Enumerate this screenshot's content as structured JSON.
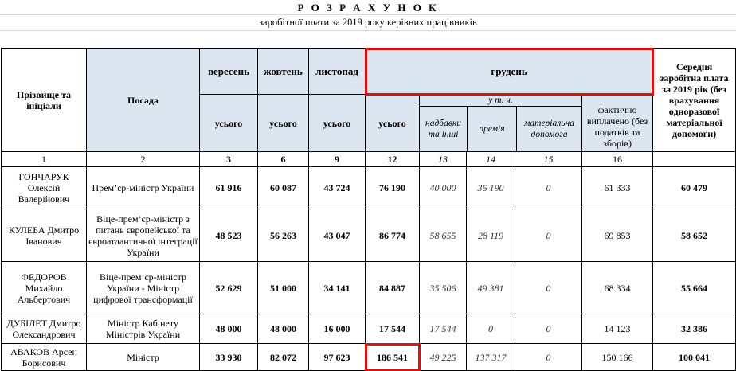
{
  "title": "Р О З Р А Х У Н О К",
  "subtitle": "заробітної плати за 2019 року керівних працівників",
  "headers": {
    "name": "Прізвище та ініціали",
    "position": "Посада",
    "sep": "вересень",
    "oct": "жовтень",
    "nov": "листопад",
    "dec": "грудень",
    "avg": "Середня заробітна плата за 2019 рік (без врахування одноразової матеріальної допомоги)",
    "total": "усього",
    "incl": "у т. ч.",
    "bonus_other": "надбавки та інші",
    "premium": "премія",
    "aid": "матеріальна допомога",
    "paid": "фактично виплачено (без податків та зборів)"
  },
  "col_numbers": [
    "1",
    "2",
    "3",
    "6",
    "9",
    "12",
    "13",
    "14",
    "15",
    "16",
    ""
  ],
  "rows": [
    {
      "name": "ГОНЧАРУК Олексій Валерійович",
      "position": "Прем’єр-міністр України",
      "sep": "61 916",
      "oct": "60 087",
      "nov": "43 724",
      "dec_total": "76 190",
      "bonus": "40 000",
      "premium": "36 190",
      "aid": "0",
      "paid": "61 333",
      "avg": "60 479"
    },
    {
      "name": "КУЛЕБА Дмитро Іванович",
      "position": "Віце-прем’єр-міністр з питань європейської та євроатлантичної інтеграції України",
      "sep": "48 523",
      "oct": "56 263",
      "nov": "43 047",
      "dec_total": "86 774",
      "bonus": "58 655",
      "premium": "28 119",
      "aid": "0",
      "paid": "69 853",
      "avg": "58 652"
    },
    {
      "name": "ФЕДОРОВ Михайло Альбертович",
      "position": "Віце-прем’єр-міністр України - Міністр цифрової трансформації",
      "sep": "52 629",
      "oct": "51 000",
      "nov": "34 141",
      "dec_total": "84 887",
      "bonus": "35 506",
      "premium": "49 381",
      "aid": "0",
      "paid": "68 334",
      "avg": "55 664"
    },
    {
      "name": "ДУБІЛЕТ Дмитро Олександрович",
      "position": "Міністр Кабінету Міністрів України",
      "sep": "48 000",
      "oct": "48 000",
      "nov": "16 000",
      "dec_total": "17 544",
      "bonus": "17 544",
      "premium": "0",
      "aid": "0",
      "paid": "14 123",
      "avg": "32 386"
    },
    {
      "name": "АВАКОВ Арсен Борисович",
      "position": "Міністр",
      "sep": "33 930",
      "oct": "82 072",
      "nov": "97 623",
      "dec_total": "186 541",
      "bonus": "49 225",
      "premium": "137 317",
      "aid": "0",
      "paid": "150 166",
      "avg": "100 041"
    }
  ]
}
